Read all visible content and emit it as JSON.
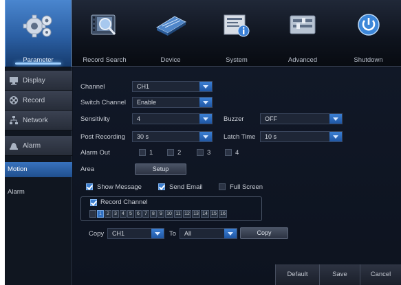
{
  "toolbar": {
    "items": [
      {
        "label": "Parameter",
        "icon": "gear-icon",
        "active": true
      },
      {
        "label": "Record Search",
        "icon": "film-search-icon"
      },
      {
        "label": "Device",
        "icon": "hard-drive-icon"
      },
      {
        "label": "System",
        "icon": "system-info-icon"
      },
      {
        "label": "Advanced",
        "icon": "advanced-settings-icon"
      },
      {
        "label": "Shutdown",
        "icon": "power-icon"
      }
    ]
  },
  "sidebar": {
    "items": [
      {
        "label": "Display",
        "icon": "monitor-icon"
      },
      {
        "label": "Record",
        "icon": "film-reel-icon"
      },
      {
        "label": "Network",
        "icon": "network-icon"
      },
      {
        "label": "Alarm",
        "icon": "alarm-bell-icon"
      }
    ],
    "subitems": [
      {
        "label": "Motion",
        "active": true
      },
      {
        "label": "Alarm"
      }
    ]
  },
  "form": {
    "channel_label": "Channel",
    "channel_value": "CH1",
    "switch_channel_label": "Switch Channel",
    "switch_channel_value": "Enable",
    "sensitivity_label": "Sensitivity",
    "sensitivity_value": "4",
    "buzzer_label": "Buzzer",
    "buzzer_value": "OFF",
    "post_recording_label": "Post Recording",
    "post_recording_value": "30 s",
    "latch_time_label": "Latch Time",
    "latch_time_value": "10 s",
    "alarm_out_label": "Alarm Out",
    "alarm_out_options": [
      "1",
      "2",
      "3",
      "4"
    ],
    "area_label": "Area",
    "setup_button": "Setup",
    "show_message_label": "Show Message",
    "send_email_label": "Send Email",
    "full_screen_label": "Full Screen",
    "record_channel_label": "Record Channel",
    "channels": [
      "1",
      "2",
      "3",
      "4",
      "5",
      "6",
      "7",
      "8",
      "9",
      "10",
      "11",
      "12",
      "13",
      "14",
      "15",
      "16"
    ],
    "copy_label": "Copy",
    "copy_from_value": "CH1",
    "to_label": "To",
    "copy_to_value": "All",
    "copy_button": "Copy"
  },
  "footer": {
    "default_button": "Default",
    "save_button": "Save",
    "cancel_button": "Cancel"
  },
  "colors": {
    "accent": "#2f6fc2",
    "background": "#0c111b"
  }
}
